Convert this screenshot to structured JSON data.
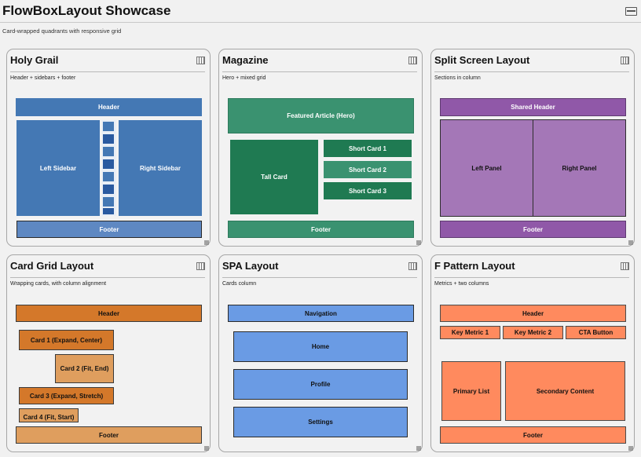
{
  "window": {
    "title": "FlowBoxLayout Showcase",
    "subtitle": "Card-wrapped quadrants with responsive grid",
    "icon": "window-card-icon"
  },
  "cards": {
    "holy_grail": {
      "title": "Holy Grail",
      "subtitle": "Header + sidebars + footer",
      "header": "Header",
      "left": "Left Sidebar",
      "right": "Right Sidebar",
      "footer": "Footer"
    },
    "magazine": {
      "title": "Magazine",
      "subtitle": "Hero + mixed grid",
      "hero": "Featured Article (Hero)",
      "tall": "Tall Card",
      "short1": "Short Card 1",
      "short2": "Short Card 2",
      "short3": "Short Card 3",
      "footer": "Footer"
    },
    "split": {
      "title": "Split Screen Layout",
      "subtitle": "Sections in column",
      "header": "Shared Header",
      "left": "Left Panel",
      "right": "Right Panel",
      "footer": "Footer"
    },
    "card_grid": {
      "title": "Card Grid Layout",
      "subtitle": "Wrapping cards, with column alignment",
      "header": "Header",
      "card1": "Card 1 (Expand, Center)",
      "card2": "Card 2 (Fit, End)",
      "card3": "Card 3 (Expand, Stretch)",
      "card4": "Card 4 (Fit, Start)",
      "footer": "Footer"
    },
    "spa": {
      "title": "SPA Layout",
      "subtitle": "Cards column",
      "nav": "Navigation",
      "home": "Home",
      "profile": "Profile",
      "settings": "Settings"
    },
    "f_pattern": {
      "title": "F Pattern Layout",
      "subtitle": "Metrics + two columns",
      "header": "Header",
      "metric1": "Key Metric 1",
      "metric2": "Key Metric 2",
      "cta": "CTA Button",
      "primary": "Primary List",
      "secondary": "Secondary Content",
      "footer": "Footer"
    }
  },
  "colors": {
    "holy_grail": "#4478b4",
    "magazine": "#1f7a52",
    "split": "#9058a8",
    "card_grid": "#d4782a",
    "spa": "#6a9be4",
    "f_pattern": "#ff8a5e"
  }
}
